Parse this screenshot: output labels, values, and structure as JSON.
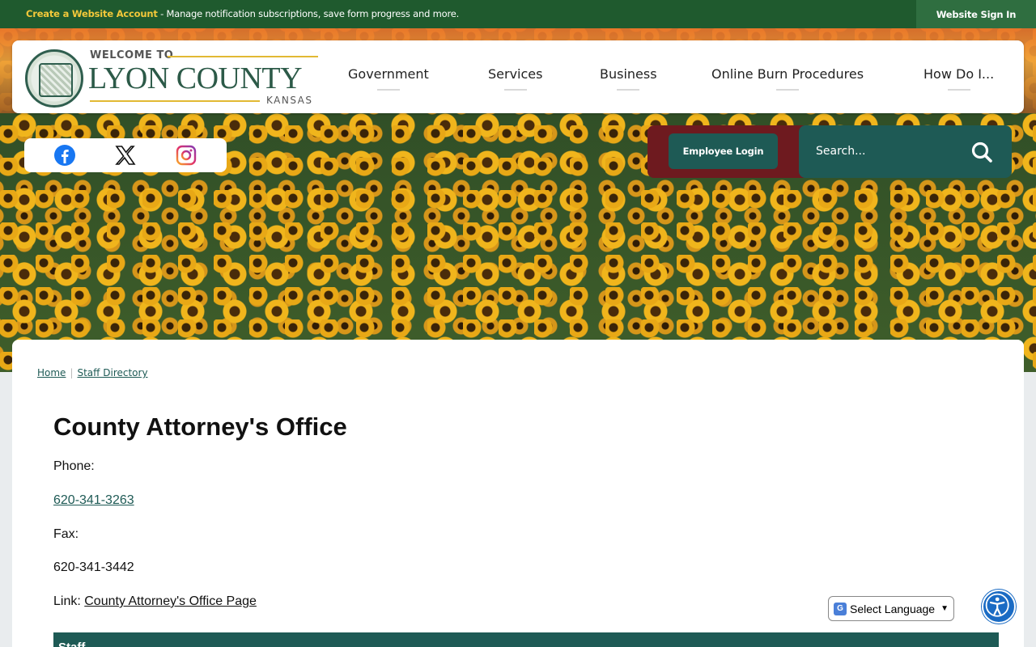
{
  "topbar": {
    "create_link": "Create a Website Account",
    "message": " - Manage notification subscriptions, save form progress and more.",
    "signin": "Website Sign In"
  },
  "logo": {
    "welcome": "WELCOME TO",
    "county": "LYON COUNTY",
    "state": "KANSAS"
  },
  "nav": {
    "items": [
      "Government",
      "Services",
      "Business",
      "Online Burn Procedures",
      "How Do I..."
    ]
  },
  "social": {
    "icons": [
      "facebook-icon",
      "x-twitter-icon",
      "instagram-icon"
    ]
  },
  "employee_login": "Employee Login",
  "search": {
    "placeholder": "Search..."
  },
  "breadcrumb": {
    "home": "Home",
    "current": "Staff Directory"
  },
  "page": {
    "title": "County Attorney's Office",
    "phone_label": "Phone:",
    "phone": "620-341-3263",
    "fax_label": "Fax:",
    "fax": "620-341-3442",
    "link_label": "Link:",
    "link_text": "County Attorney's Office Page",
    "staff_header": "Staff"
  },
  "translate": {
    "label": "Select Language"
  },
  "colors": {
    "brand_green": "#1f5a2e",
    "teal": "#1e5a55",
    "maroon": "#6e1a1f",
    "gold": "#f3c83a"
  }
}
